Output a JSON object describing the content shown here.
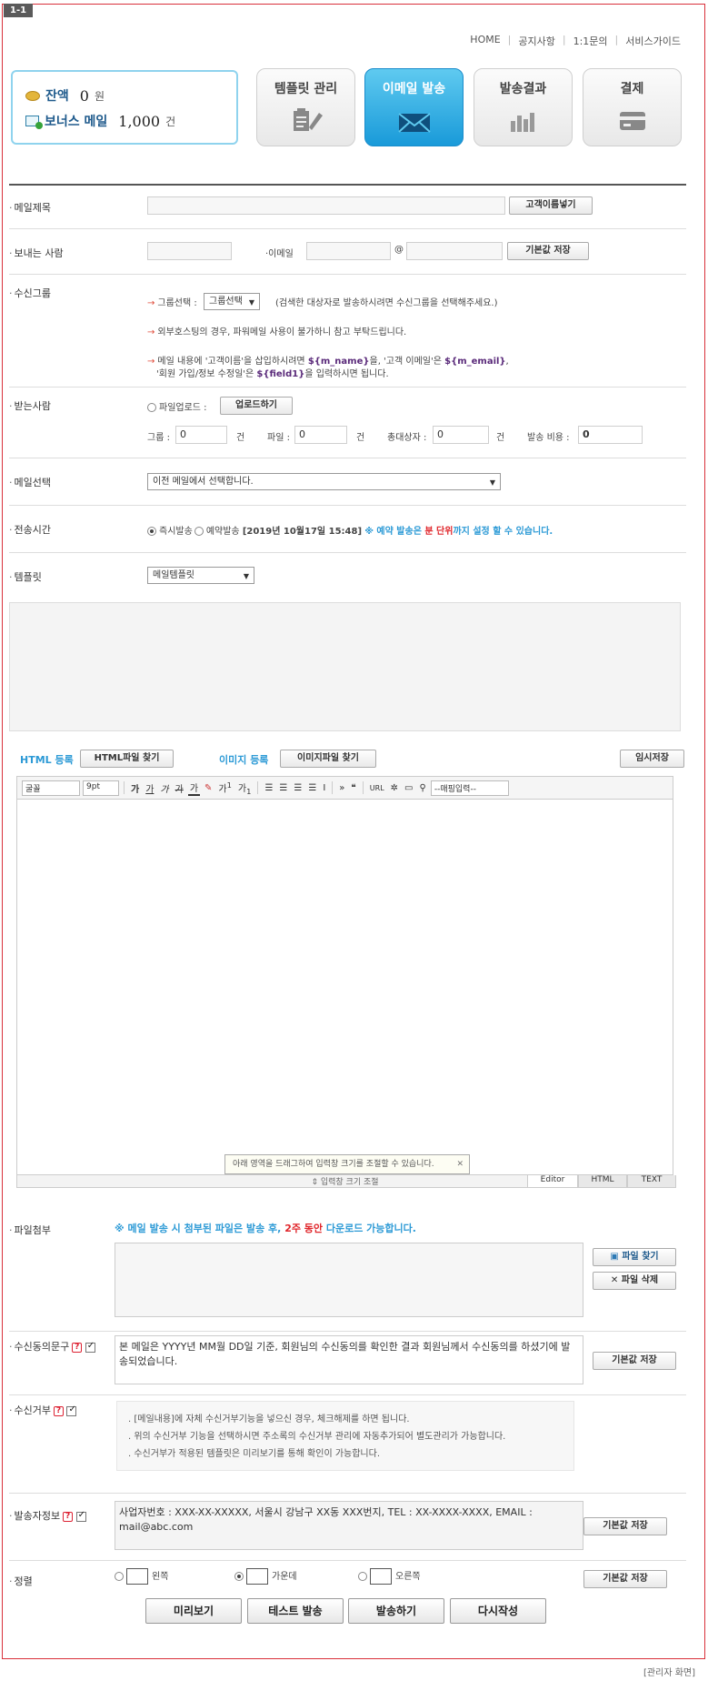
{
  "corner_tag": "1-1",
  "topnav": [
    "HOME",
    "공지사항",
    "1:1문의",
    "서비스가이드"
  ],
  "balance": {
    "label1": "잔액",
    "value1": "0",
    "unit1": "원",
    "label2": "보너스 메일",
    "value2": "1,000",
    "unit2": "건"
  },
  "menu": [
    {
      "label": "템플릿 관리",
      "icon": "clipboard-pencil-icon"
    },
    {
      "label": "이메일 발송",
      "icon": "envelope-icon"
    },
    {
      "label": "발송결과",
      "icon": "bar-chart-icon"
    },
    {
      "label": "결제",
      "icon": "credit-card-icon"
    }
  ],
  "subject": {
    "label": "메일제목",
    "btn": "고객이름넣기"
  },
  "sender": {
    "label": "보내는 사람",
    "email_label": "·이메일",
    "at": "@",
    "btn": "기본값 저장"
  },
  "group": {
    "label": "수신그룹",
    "select_label": "그룹선택 :",
    "select_value": "그룹선택",
    "select_hint": "(검색한 대상자로 발송하시려면 수신그룹을 선택해주세요.)",
    "note1": "외부호스팅의 경우, 파워메일 사용이 불가하니 참고 부탁드립니다.",
    "note2a": "메일 내용에 '고객이름'을 삽입하시려면 ",
    "note2b": "${m_name}",
    "note2c": "을, '고객 이메일'은 ",
    "note2d": "${m_email}",
    "note2e": ",",
    "note3a": "'회원 가입/정보 수정일'은 ",
    "note3b": "${field1}",
    "note3c": "을 입력하시면 됩니다."
  },
  "recipient": {
    "label": "받는사람",
    "upload_label": "파일업로드 :",
    "upload_btn": "업로드하기",
    "group_label": "그룹 :",
    "group_val": "0",
    "unit": "건",
    "file_label": "파일 :",
    "file_val": "0",
    "total_label": "총대상자 :",
    "total_val": "0",
    "cost_label": "발송 비용 :",
    "cost_val": "0"
  },
  "mail_select": {
    "label": "메일선택",
    "value": "이전 메일에서 선택합니다."
  },
  "send_time": {
    "label": "전송시간",
    "now": "즉시발송",
    "reserve": "예약발송",
    "datetime": "[2019년 10월17일 15:48]",
    "notice_a": "※ 예약 발송은 ",
    "notice_b": "분 단위",
    "notice_c": "까지 설정 할 수 있습니다."
  },
  "template": {
    "label": "템플릿",
    "value": "메일템플릿"
  },
  "html_reg": {
    "label": "HTML 등록",
    "btn": "HTML파일 찾기"
  },
  "img_reg": {
    "label": "이미지 등록",
    "btn": "이미지파일 찾기"
  },
  "temp_save": "임시저장",
  "editor": {
    "font": "굴꼴",
    "size": "9pt",
    "fmt": [
      "가",
      "가",
      "가",
      "가",
      "가"
    ],
    "super": "가",
    "sub": "가",
    "quote": "❝",
    "url": "URL",
    "mapping": "--매핑입력--",
    "resize_tip": "아래 영역을 드래그하여 입력창 크기를 조절할 수 있습니다.",
    "resize_label": "입력창 크기 조절",
    "tabs": [
      "Editor",
      "HTML",
      "TEXT"
    ]
  },
  "attach": {
    "label": "파일첨부",
    "notice_a": "※ 메일 발송 시 첨부된 파일은 발송 후, ",
    "notice_b": "2주 동안",
    "notice_c": " 다운로드 가능합니다.",
    "find_btn": "파일 찾기",
    "delete_btn": "파일 삭제"
  },
  "consent": {
    "label": "수신동의문구",
    "text": "본 메일은 YYYY년 MM월 DD일 기준, 회원님의 수신동의를 확인한 결과 회원님께서 수신동의를 하셨기에 발송되었습니다.",
    "btn": "기본값 저장"
  },
  "reject": {
    "label": "수신거부",
    "notes": [
      ". [메일내용]에 자체 수신거부기능을 넣으신 경우, 체크해제를 하면 됩니다.",
      ". 위의 수신거부 기능을 선택하시면 주소록의 수신거부 관리에 자동추가되어 별도관리가 가능합니다.",
      ". 수신거부가 적용된 템플릿은 미리보기를 통해 확인이 가능합니다."
    ]
  },
  "sender_info": {
    "label": "발송자정보",
    "text": "사업자번호 : XXX-XX-XXXXX, 서울시 강남구 XX동 XXX번지, TEL : XX-XXXX-XXXX, EMAIL : mail@abc.com",
    "btn": "기본값 저장"
  },
  "align": {
    "label": "정렬",
    "left": "왼쪽",
    "center": "가운데",
    "right": "오른쪽",
    "btn": "기본값 저장"
  },
  "actions": [
    "미리보기",
    "테스트 발송",
    "발송하기",
    "다시작성"
  ],
  "footer_caption": "[관리자 화면]"
}
